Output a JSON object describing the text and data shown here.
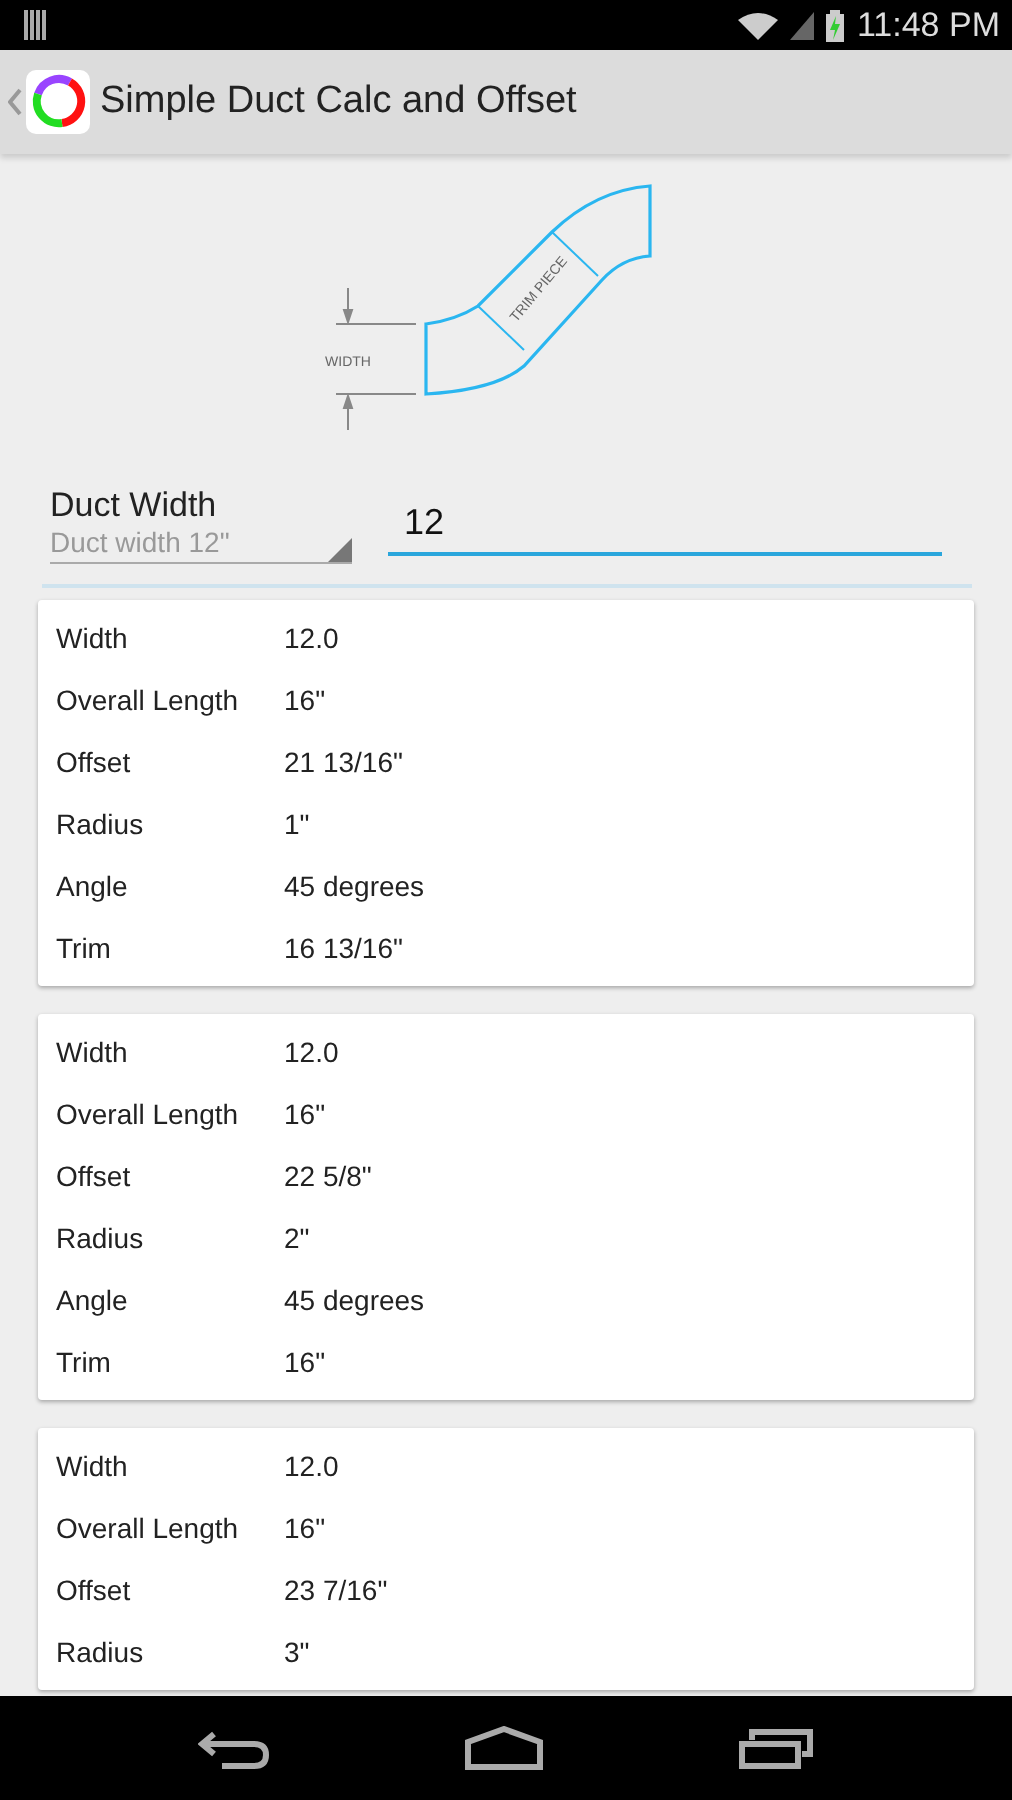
{
  "status_bar": {
    "time": "11:48 PM"
  },
  "action_bar": {
    "title": "Simple Duct Calc and Offset"
  },
  "diagram": {
    "width_label": "WIDTH",
    "trim_label": "TRIM PIECE"
  },
  "form": {
    "label": "Duct Width",
    "spinner_value": "Duct width 12\"",
    "input_value": "12"
  },
  "cards": [
    {
      "rows": [
        {
          "label": "Width",
          "value": "12.0"
        },
        {
          "label": "Overall Length",
          "value": "16\""
        },
        {
          "label": "Offset",
          "value": "21 13/16\""
        },
        {
          "label": "Radius",
          "value": "1\""
        },
        {
          "label": "Angle",
          "value": "45 degrees"
        },
        {
          "label": "Trim",
          "value": "16 13/16\""
        }
      ]
    },
    {
      "rows": [
        {
          "label": "Width",
          "value": "12.0"
        },
        {
          "label": "Overall Length",
          "value": "16\""
        },
        {
          "label": "Offset",
          "value": "22 5/8\""
        },
        {
          "label": "Radius",
          "value": "2\""
        },
        {
          "label": "Angle",
          "value": "45 degrees"
        },
        {
          "label": "Trim",
          "value": "16\""
        }
      ]
    },
    {
      "rows": [
        {
          "label": "Width",
          "value": "12.0"
        },
        {
          "label": "Overall Length",
          "value": "16\""
        },
        {
          "label": "Offset",
          "value": "23 7/16\""
        },
        {
          "label": "Radius",
          "value": "3\""
        }
      ]
    }
  ]
}
